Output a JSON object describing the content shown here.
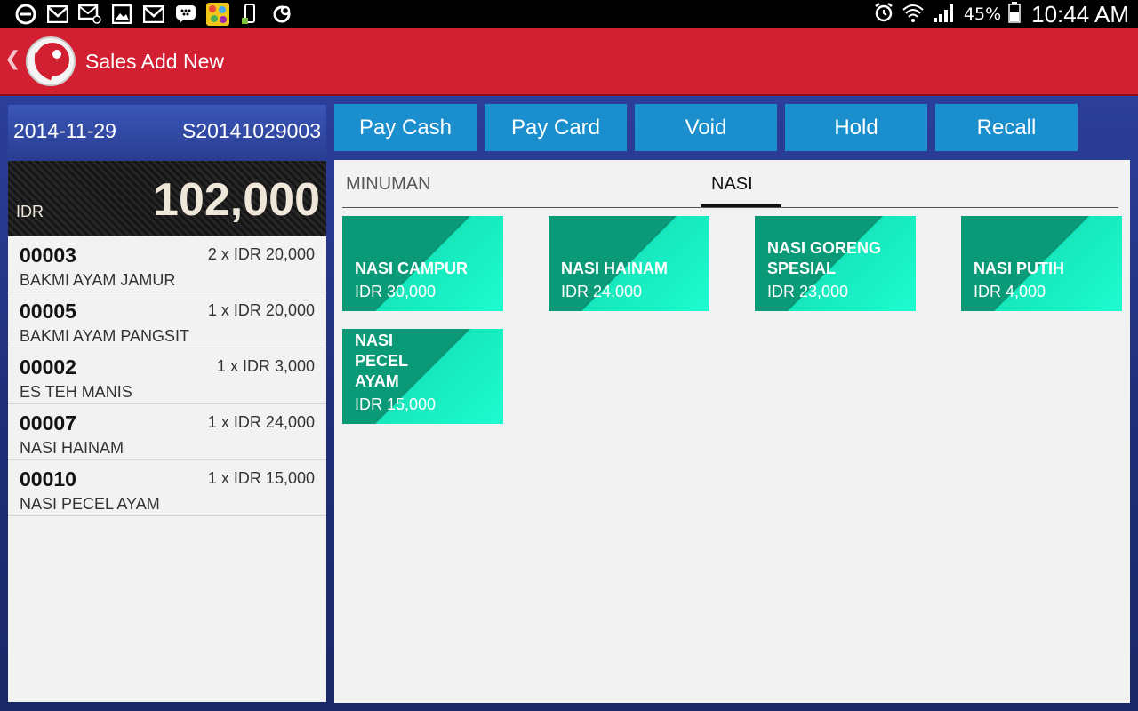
{
  "status_bar": {
    "icons": [
      "block-icon",
      "gmail-icon",
      "email-icon",
      "gallery-icon",
      "gmail-icon",
      "bbm-icon",
      "game-icon",
      "phone-icon",
      "sync-icon"
    ],
    "battery": "45%",
    "time": "10:44 AM"
  },
  "app_bar": {
    "title": "Sales Add New"
  },
  "order": {
    "date": "2014-11-29",
    "number": "S20141029003",
    "currency": "IDR",
    "total": "102,000",
    "items": [
      {
        "code": "00003",
        "qty": "2 x IDR 20,000",
        "name": "BAKMI AYAM JAMUR"
      },
      {
        "code": "00005",
        "qty": "1 x IDR 20,000",
        "name": "BAKMI AYAM PANGSIT"
      },
      {
        "code": "00002",
        "qty": "1 x IDR 3,000",
        "name": "ES TEH MANIS"
      },
      {
        "code": "00007",
        "qty": "1 x IDR 24,000",
        "name": "NASI HAINAM"
      },
      {
        "code": "00010",
        "qty": "1 x IDR 15,000",
        "name": "NASI PECEL AYAM"
      }
    ]
  },
  "actions": {
    "pay_cash": "Pay Cash",
    "pay_card": "Pay Card",
    "void": "Void",
    "hold": "Hold",
    "recall": "Recall"
  },
  "categories": {
    "tabs": [
      "MINUMAN",
      "NASI"
    ],
    "active": "NASI"
  },
  "products": [
    {
      "name": "NASI CAMPUR",
      "price": "IDR 30,000"
    },
    {
      "name": "NASI HAINAM",
      "price": "IDR 24,000"
    },
    {
      "name": "NASI GORENG SPESIAL",
      "price": "IDR 23,000"
    },
    {
      "name": "NASI PUTIH",
      "price": "IDR 4,000"
    },
    {
      "name": "NASI PECEL AYAM",
      "price": "IDR 15,000"
    }
  ],
  "colors": {
    "app_bar": "#d21f31",
    "button": "#1b8fce",
    "tile_dark": "#0a9a78",
    "tile_light": "#1dfccf"
  }
}
